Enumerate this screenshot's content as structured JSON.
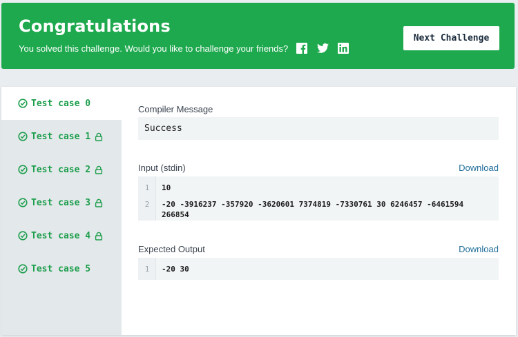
{
  "banner": {
    "title": "Congratulations",
    "subtitle": "You solved this challenge. Would you like to challenge your friends?",
    "next_button": "Next Challenge",
    "social": [
      "facebook-icon",
      "twitter-icon",
      "linkedin-icon"
    ],
    "color": "#1ea94e"
  },
  "tabs": [
    {
      "label": "Test case 0",
      "locked": false,
      "active": true
    },
    {
      "label": "Test case 1",
      "locked": true,
      "active": false
    },
    {
      "label": "Test case 2",
      "locked": true,
      "active": false
    },
    {
      "label": "Test case 3",
      "locked": true,
      "active": false
    },
    {
      "label": "Test case 4",
      "locked": true,
      "active": false
    },
    {
      "label": "Test case 5",
      "locked": false,
      "active": false
    }
  ],
  "compiler": {
    "label": "Compiler Message",
    "message": "Success"
  },
  "input": {
    "label": "Input (stdin)",
    "download": "Download",
    "lines": [
      {
        "no": "1",
        "text": "10"
      },
      {
        "no": "2",
        "text": "-20 -3916237 -357920 -3620601 7374819 -7330761 30 6246457 -6461594 266854"
      }
    ]
  },
  "expected": {
    "label": "Expected Output",
    "download": "Download",
    "lines": [
      {
        "no": "1",
        "text": "-20 30"
      }
    ]
  },
  "colors": {
    "accent_green": "#1c9e4b",
    "link_blue": "#1f6d99"
  }
}
